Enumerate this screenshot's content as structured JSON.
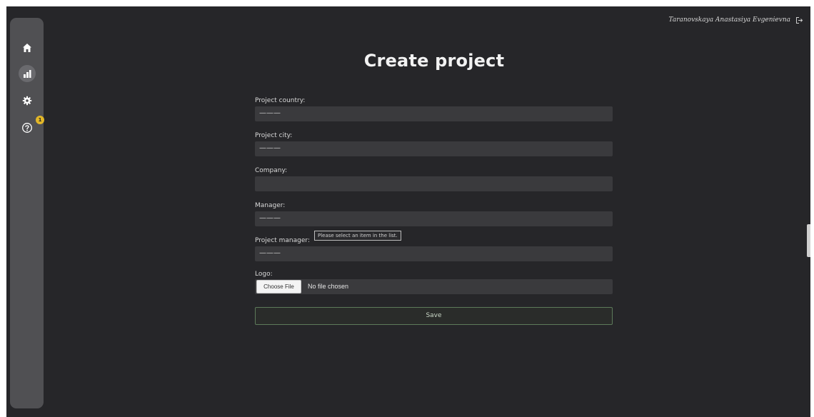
{
  "header": {
    "user_name": "Taranovskaya Anastasiya Evgenievna",
    "logout_icon": "logout-icon"
  },
  "sidebar": {
    "items": [
      {
        "name": "home",
        "icon": "home-icon"
      },
      {
        "name": "analytics",
        "icon": "bar-chart-icon",
        "active": true
      },
      {
        "name": "settings",
        "icon": "gear-icon"
      },
      {
        "name": "help",
        "icon": "question-icon",
        "badge": "1"
      }
    ],
    "badge_color": "#e3b728"
  },
  "page": {
    "title": "Create project"
  },
  "form": {
    "fields": [
      {
        "label": "Project country:",
        "value": "———"
      },
      {
        "label": "Project city:",
        "value": "———"
      },
      {
        "label": "Company:",
        "value": ""
      },
      {
        "label": "Manager:",
        "value": "———"
      },
      {
        "label": "Project manager:",
        "value": "———",
        "tooltip": "Please select an item in the list."
      }
    ],
    "logo": {
      "label": "Logo:",
      "button": "Choose File",
      "status": "No file chosen"
    },
    "save_label": "Save"
  },
  "colors": {
    "background": "#262629",
    "sidebar": "#505053",
    "input": "#3a3a3d",
    "save_border": "#5d7a5a"
  }
}
